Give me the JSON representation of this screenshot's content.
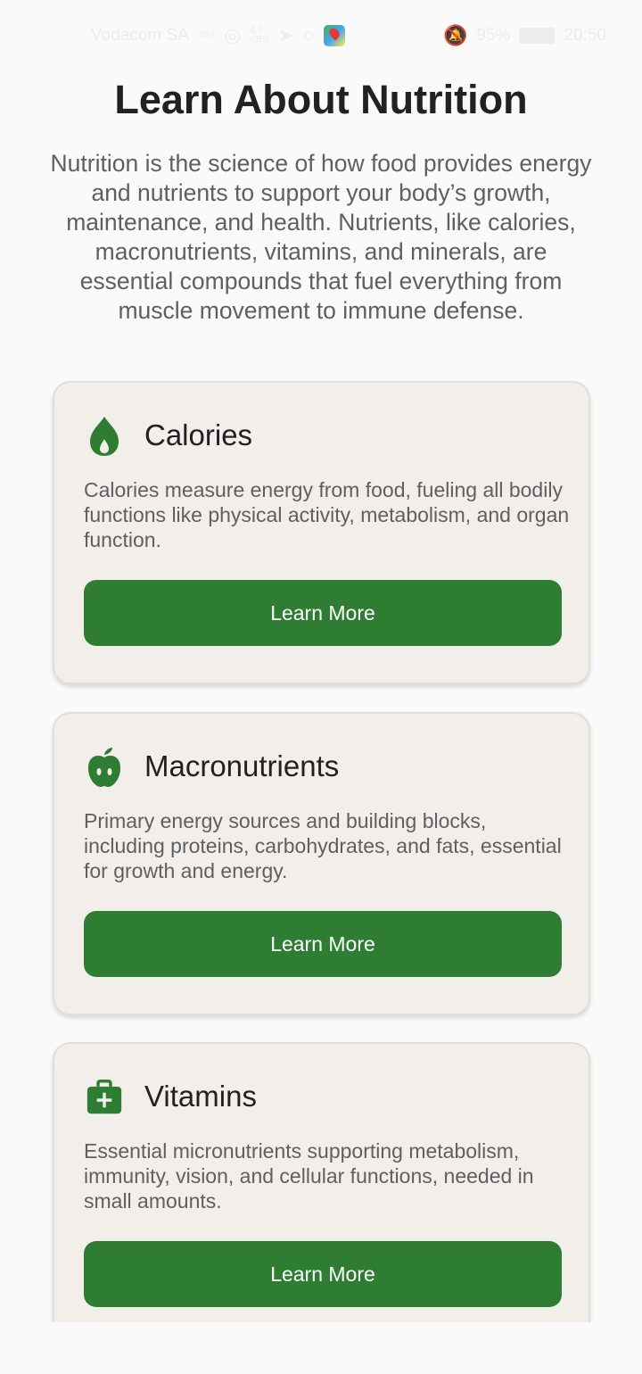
{
  "status_bar": {
    "carrier": "Vodacom SA",
    "net_small_top": "4G+",
    "net_small_bottom": "",
    "speed_top": "4.0",
    "speed_bottom": "KB/s",
    "battery_percent": "95%",
    "time": "20:50"
  },
  "page": {
    "title": "Learn About Nutrition",
    "intro": "Nutrition is the science of how food provides energy and nutrients to support your body’s growth, maintenance, and health. Nutrients, like calories, macronutrients, vitamins, and minerals, are essential compounds that fuel everything from muscle movement to immune defense."
  },
  "cards": [
    {
      "icon": "flame-icon",
      "title": "Calories",
      "description": "Calories measure energy from food, fueling all bodily functions like physical activity, metabolism, and organ function.",
      "button_label": "Learn More"
    },
    {
      "icon": "apple-icon",
      "title": "Macronutrients",
      "description": "Primary energy sources and building blocks, including proteins, carbohydrates, and fats, essential for growth and energy.",
      "button_label": "Learn More"
    },
    {
      "icon": "medical-kit-icon",
      "title": "Vitamins",
      "description": "Essential micronutrients supporting metabolism, immunity, vision, and cellular functions, needed in small amounts.",
      "button_label": "Learn More"
    }
  ],
  "colors": {
    "accent": "#2e7d32",
    "card_background": "#f2efeb",
    "page_background": "#fafafa"
  }
}
